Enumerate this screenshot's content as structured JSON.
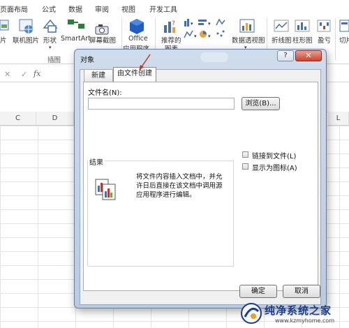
{
  "ribbon": {
    "tabs": [
      "页面布局",
      "公式",
      "数据",
      "审阅",
      "视图",
      "开发工具"
    ],
    "buttons": {
      "pictures": "片",
      "online_pictures": "联机图片",
      "shapes": "形状",
      "smartart": "SmartArt",
      "screenshot": "屏幕截图",
      "office_apps": "Office",
      "office_apps_line2": "应用程序",
      "recommended_charts": "推荐的",
      "recommended_charts_line2": "图表",
      "pivot_chart": "数据透视图",
      "line": "折线图",
      "column": "柱形图",
      "winloss": "盈亏",
      "slicer": "切片"
    },
    "group_label": "插图"
  },
  "formula_bar": {
    "fx": "fx"
  },
  "columns": [
    "C",
    "D",
    "L"
  ],
  "dialog": {
    "title": "对象",
    "help": "?",
    "close": "✕",
    "tabs": [
      "新建",
      "由文件创建"
    ],
    "filename_label": "文件名(N):",
    "filename_value": "",
    "browse": "浏览(B)...",
    "link_to_file": "链接到文件(L)",
    "display_as_icon": "显示为图标(A)",
    "result_label": "结果",
    "result_text": "将文件内容插入文档中，并允许日后直接在该文档中调用源应用程序进行编辑。",
    "ok": "确定",
    "cancel": "取消"
  },
  "watermark": {
    "name": "纯净系统之家",
    "url": "www.kzmyhome.com"
  }
}
